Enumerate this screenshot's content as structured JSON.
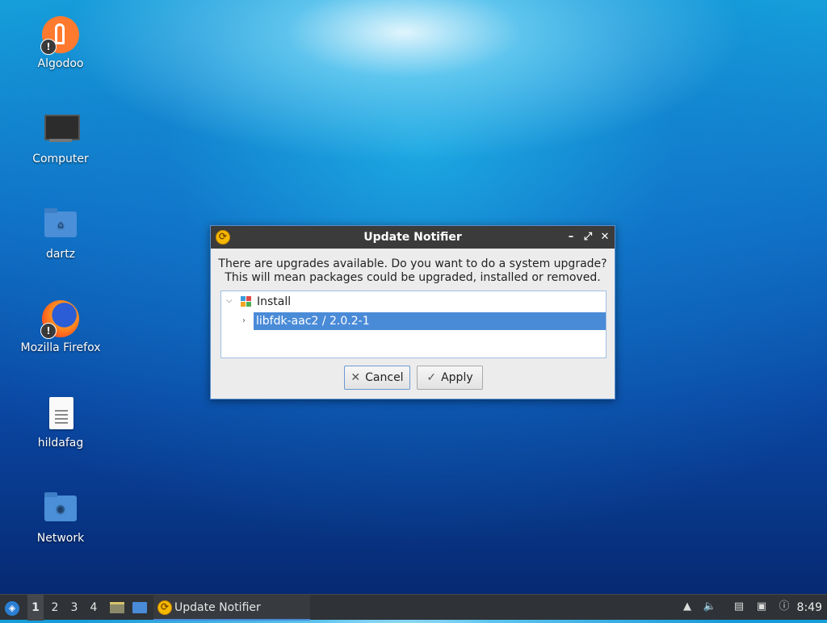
{
  "desktop": {
    "icons": [
      {
        "label": "Algodoo"
      },
      {
        "label": "Computer"
      },
      {
        "label": "dartz"
      },
      {
        "label": "Mozilla Firefox"
      },
      {
        "label": "hildafag"
      },
      {
        "label": "Network"
      }
    ]
  },
  "dialog": {
    "title": "Update Notifier",
    "window_buttons": {
      "minimize": "–",
      "maximize": "⤢",
      "close": "✕"
    },
    "message_line1": "There are upgrades available. Do you want to do a system upgrade?",
    "message_line2": "This will mean packages could be upgraded, installed or removed.",
    "tree": {
      "group_label": "Install",
      "package_label": "libfdk-aac2  /  2.0.2-1"
    },
    "buttons": {
      "cancel": "Cancel",
      "apply": "Apply"
    }
  },
  "taskbar": {
    "workspaces": [
      "1",
      "2",
      "3",
      "4"
    ],
    "active_workspace": "1",
    "task_label": "Update Notifier",
    "clock": "8:49"
  },
  "colors": {
    "selection": "#4a8bd8",
    "titlebar": "#3b3b3b",
    "taskbar": "#2f3236"
  }
}
